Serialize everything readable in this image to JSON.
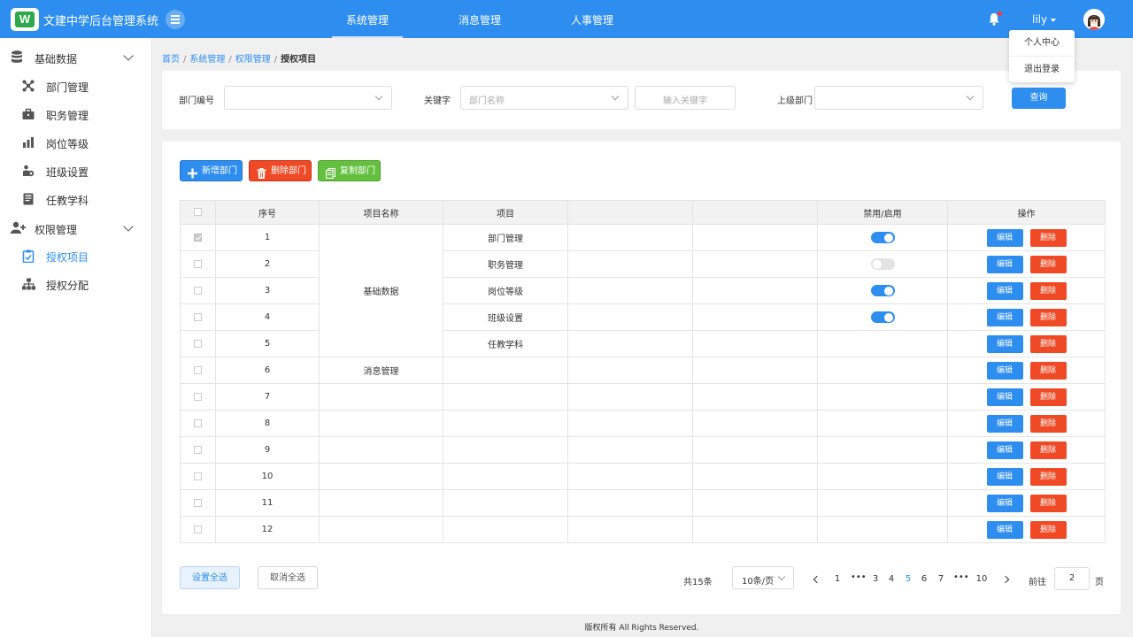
{
  "header": {
    "app_title": "文建中学后台管理系统",
    "logo_letter": "W",
    "nav": [
      {
        "label": "系统管理",
        "active": true
      },
      {
        "label": "消息管理",
        "active": false
      },
      {
        "label": "人事管理",
        "active": false
      }
    ],
    "user_name": "lily",
    "has_notification": true
  },
  "user_menu": [
    "个人中心",
    "退出登录"
  ],
  "sidebar": {
    "groups": [
      {
        "label": "基础数据",
        "icon": "database-icon",
        "expanded": true,
        "items": [
          {
            "label": "部门管理",
            "icon": "network-icon"
          },
          {
            "label": "职务管理",
            "icon": "briefcase-icon"
          },
          {
            "label": "岗位等级",
            "icon": "bar-chart-icon"
          },
          {
            "label": "班级设置",
            "icon": "class-icon"
          },
          {
            "label": "任教学科",
            "icon": "book-icon"
          }
        ]
      },
      {
        "label": "权限管理",
        "icon": "user-add-icon",
        "expanded": true,
        "items": [
          {
            "label": "授权项目",
            "icon": "clipboard-check-icon",
            "active": true
          },
          {
            "label": "授权分配",
            "icon": "org-chart-icon"
          }
        ]
      }
    ]
  },
  "breadcrumb": [
    "首页",
    "系统管理",
    "权限管理",
    "授权项目"
  ],
  "filters": {
    "dept_code_label": "部门编号",
    "keyword_label": "关键字",
    "dept_name_placeholder": "部门名称",
    "keyword_placeholder": "输入关键字",
    "parent_dept_label": "上级部门",
    "query_button": "查询"
  },
  "toolbar": {
    "add": "新增部门",
    "delete": "删除部门",
    "copy": "复制部门"
  },
  "table": {
    "headers": [
      "序号",
      "项目名称",
      "项目",
      "",
      "",
      "禁用/启用",
      "操作"
    ],
    "group_names": [
      "基础数据",
      "消息管理"
    ],
    "rows": [
      {
        "no": "1",
        "checked": true,
        "item": "部门管理",
        "toggle": "on"
      },
      {
        "no": "2",
        "checked": false,
        "item": "职务管理",
        "toggle": "off"
      },
      {
        "no": "3",
        "checked": false,
        "item": "岗位等级",
        "toggle": "on"
      },
      {
        "no": "4",
        "checked": false,
        "item": "班级设置",
        "toggle": "on"
      },
      {
        "no": "5",
        "checked": false,
        "item": "任教学科",
        "toggle": ""
      },
      {
        "no": "6",
        "checked": false,
        "item": "",
        "toggle": ""
      },
      {
        "no": "7",
        "checked": false,
        "item": "",
        "toggle": ""
      },
      {
        "no": "8",
        "checked": false,
        "item": "",
        "toggle": ""
      },
      {
        "no": "9",
        "checked": false,
        "item": "",
        "toggle": ""
      },
      {
        "no": "10",
        "checked": false,
        "item": "",
        "toggle": ""
      },
      {
        "no": "11",
        "checked": false,
        "item": "",
        "toggle": ""
      },
      {
        "no": "12",
        "checked": false,
        "item": "",
        "toggle": ""
      }
    ],
    "edit_label": "编辑",
    "delete_label": "删除"
  },
  "bottom": {
    "select_all": "设置全选",
    "clear_all": "取消全选"
  },
  "pagination": {
    "total": "共15条",
    "page_size": "10条/页",
    "pages": [
      "1",
      "•••",
      "3",
      "4",
      "5",
      "6",
      "7",
      "•••",
      "10"
    ],
    "current": "5",
    "goto_label": "前往",
    "goto_value": "2",
    "goto_unit": "页"
  },
  "footer": "版权所有  All Rights Reserved.",
  "colors": {
    "primary": "#2e8ef0",
    "danger": "#ef4a25",
    "success": "#64c13f"
  }
}
